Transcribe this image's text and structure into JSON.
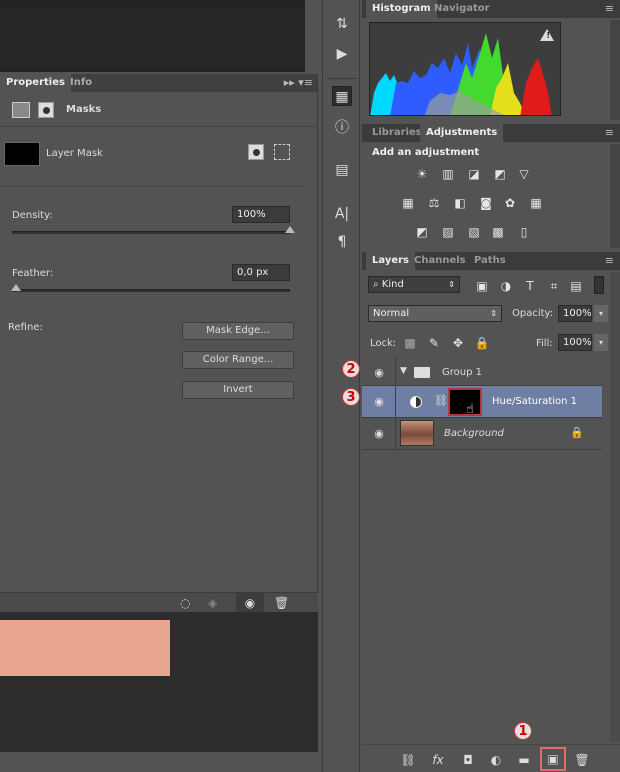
{
  "properties": {
    "tabs": [
      "Properties",
      "Info"
    ],
    "section_title": "Masks",
    "mask_label": "Layer Mask",
    "density_label": "Density:",
    "density_value": "100%",
    "density_fraction": 1.0,
    "feather_label": "Feather:",
    "feather_value": "0,0 px",
    "feather_fraction": 0.0,
    "refine_label": "Refine:",
    "buttons": [
      "Mask Edge...",
      "Color Range...",
      "Invert"
    ]
  },
  "right_panel": {
    "histogram_tabs": [
      "Histogram",
      "Navigator"
    ],
    "warning_icon": "!",
    "adj_tabs": [
      "Libraries",
      "Adjustments"
    ],
    "adj_heading": "Add an adjustment",
    "layers_tabs": [
      "Layers",
      "Channels",
      "Paths"
    ],
    "filter_kind": "Kind",
    "blend_mode": "Normal",
    "opacity_label": "Opacity:",
    "opacity_value": "100%",
    "lock_label": "Lock:",
    "fill_label": "Fill:",
    "fill_value": "100%"
  },
  "layers": [
    {
      "name": "Group 1",
      "type": "group",
      "badge": "2"
    },
    {
      "name": "Hue/Saturation 1",
      "type": "adjustment",
      "badge": "3",
      "selected": true
    },
    {
      "name": "Background",
      "type": "pixel",
      "locked": true
    }
  ],
  "bottom_badge": "1",
  "colors": {
    "panel_bg": "#535353",
    "selected_row": "#6e7fa3",
    "badge_red": "#cc0000",
    "skin_swatch": "#e8a590"
  }
}
